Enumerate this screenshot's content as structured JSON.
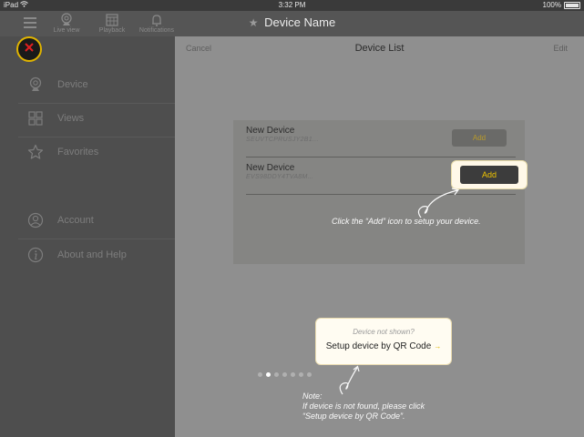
{
  "status_bar": {
    "device": "iPad",
    "time": "3:32 PM",
    "battery": "100%"
  },
  "header": {
    "title": "Device Name",
    "tabs": [
      {
        "label": "Live view"
      },
      {
        "label": "Playback"
      },
      {
        "label": "Notifications"
      }
    ]
  },
  "sidebar": {
    "items": [
      {
        "label": "Device",
        "icon": "webcam-icon"
      },
      {
        "label": "Views",
        "icon": "grid-icon"
      },
      {
        "label": "Favorites",
        "icon": "star-icon"
      },
      {
        "label": "Account",
        "icon": "user-icon"
      },
      {
        "label": "About and Help",
        "icon": "info-icon"
      }
    ],
    "close_label": "X"
  },
  "device_list": {
    "cancel": "Cancel",
    "title": "Device List",
    "edit": "Edit",
    "devices": [
      {
        "name": "New Device",
        "id": "SEUVTCPRUSJY2B1...",
        "action": "Add"
      },
      {
        "name": "New Device",
        "id": "EVS98DDY4TVA8M...",
        "action": "Add"
      }
    ]
  },
  "tutorial": {
    "add_tip": "Click the “Add” icon to setup your device.",
    "not_shown": "Device not shown?",
    "qr_setup": "Setup device by QR Code",
    "note_title": "Note:",
    "note_line1": "If device is not found, please click",
    "note_line2": "“Setup device by QR Code”."
  },
  "colors": {
    "accent": "#f0c400",
    "sidebar_bg": "#4e4e4e",
    "overlay_bg": "#8f8f8f"
  }
}
